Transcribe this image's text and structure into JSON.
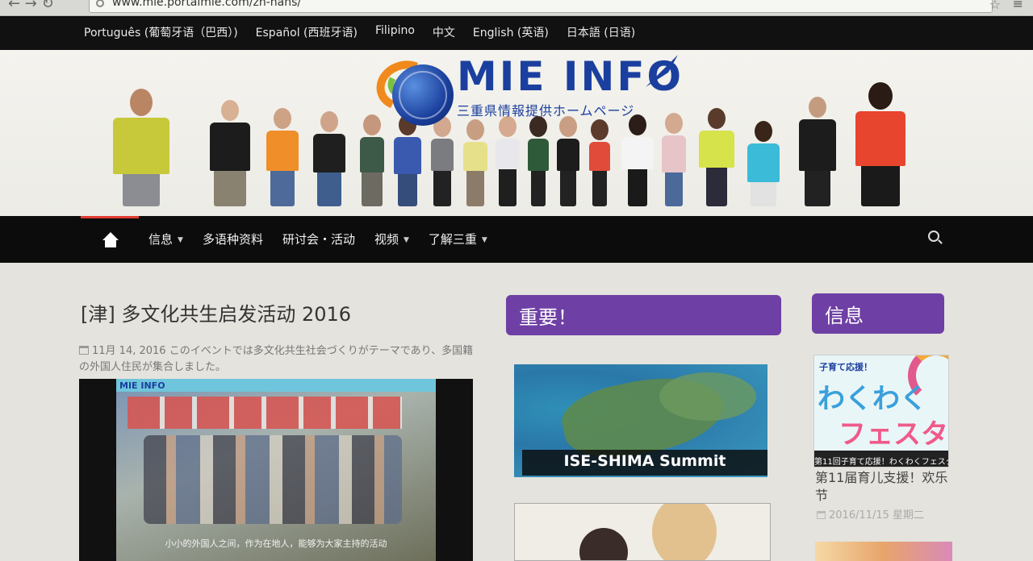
{
  "browser": {
    "url": "www.mie.portalmie.com/zh-hans/"
  },
  "language_bar": {
    "items": [
      "Português (葡萄牙语（巴西）)",
      "Español (西班牙语)",
      "Filipino",
      "中文",
      "English (英语)",
      "日本語 (日语)"
    ]
  },
  "banner": {
    "logo_title": "MIE INFO",
    "logo_subtitle": "三重県情報提供ホームページ"
  },
  "main_nav": {
    "home_icon": "home-icon",
    "items": [
      {
        "label": "信息",
        "has_dropdown": true
      },
      {
        "label": "多语种资料",
        "has_dropdown": false
      },
      {
        "label": "研讨会・活动",
        "has_dropdown": false
      },
      {
        "label": "视频",
        "has_dropdown": true
      },
      {
        "label": "了解三重",
        "has_dropdown": true
      }
    ],
    "search_icon": "search-icon"
  },
  "post": {
    "title": "[津] 多文化共生启发活动 2016",
    "date": "11月 14, 2016",
    "excerpt": "このイベントでは多文化共生社会づくりがテーマであり、多国籍の外国人住民が集合しました。",
    "video": {
      "top_logo": "MIE INFO",
      "caption": "小小的外国人之间，作为在地人，能够为大家主持的活动"
    }
  },
  "important": {
    "header": "重要！",
    "items": [
      {
        "label": "ISE-SHIMA Summit"
      }
    ]
  },
  "info": {
    "header": "信息",
    "festa": {
      "top_text": "子育て応援！",
      "big_text_1": "わくわく",
      "big_text_2": "フェスタ",
      "strip_text": "第11回子育て応援！わくわくフェスタ",
      "title": "第11届育儿支援！欢乐节",
      "date": "2016/11/15 星期二"
    }
  },
  "colors": {
    "accent_purple": "#6e3fa4",
    "nav_active_red": "#e23b2e",
    "logo_blue": "#1b3f9e"
  }
}
